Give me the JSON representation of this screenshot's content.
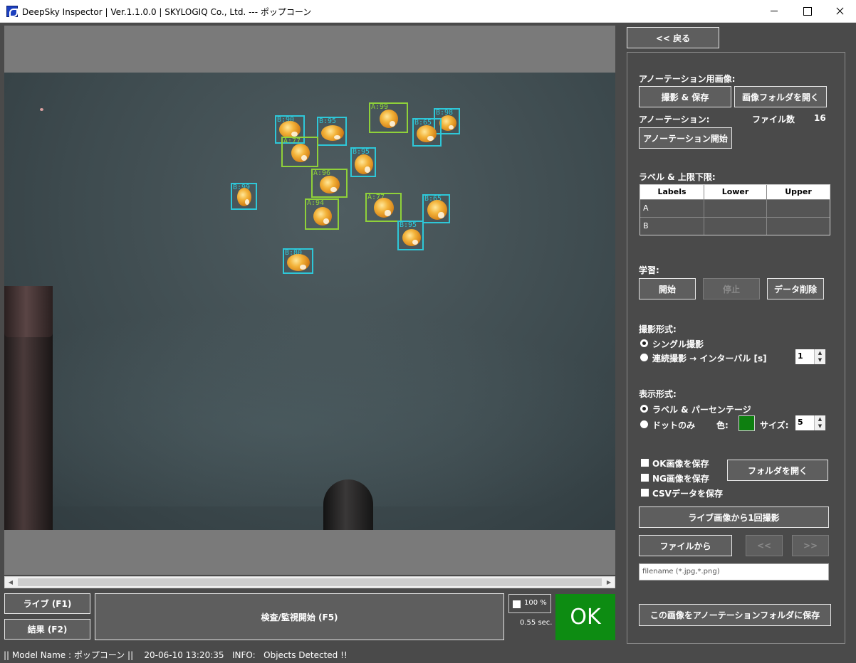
{
  "window": {
    "title": "DeepSky Inspector | Ver.1.1.0.0 | SKYLOGIQ Co., Ltd. --- ポップコーン"
  },
  "viewer": {
    "detections": [
      {
        "cls": "B",
        "label": "B:90"
      },
      {
        "cls": "B",
        "label": "B:95"
      },
      {
        "cls": "A",
        "label": "A:99"
      },
      {
        "cls": "B",
        "label": "B:98"
      },
      {
        "cls": "B",
        "label": "B:65"
      },
      {
        "cls": "A",
        "label": "A:77"
      },
      {
        "cls": "B",
        "label": "B:95"
      },
      {
        "cls": "A",
        "label": "A:96"
      },
      {
        "cls": "B",
        "label": "B:99"
      },
      {
        "cls": "A",
        "label": "A:94"
      },
      {
        "cls": "A",
        "label": "A:77"
      },
      {
        "cls": "B",
        "label": "B:65"
      },
      {
        "cls": "B",
        "label": "B:95"
      },
      {
        "cls": "B",
        "label": "B:80"
      }
    ]
  },
  "bottom": {
    "live_label": "ライブ (F1)",
    "result_label": "結果 (F2)",
    "inspect_label": "検査/監視開始 (F5)",
    "percent": "100 %",
    "elapsed": "0.55 sec.",
    "verdict": "OK"
  },
  "status": {
    "text": "|| Model Name : ポップコーン ||    20-06-10 13:20:35   INFO:   Objects Detected !!"
  },
  "panel": {
    "back_label": "<< 戻る",
    "annotation_image_heading": "アノーテーション用画像:",
    "capture_save_label": "撮影 & 保存",
    "open_image_folder_label": "画像フォルダを開く",
    "annotation_heading": "アノーテーション:",
    "file_count_label": "ファイル数",
    "file_count_value": "16",
    "start_annotation_label": "アノーテーション開始",
    "limits_heading": "ラベル & 上限下限:",
    "table": {
      "headers": [
        "Labels",
        "Lower",
        "Upper"
      ],
      "rows": [
        [
          "A",
          "",
          ""
        ],
        [
          "B",
          "",
          ""
        ]
      ]
    },
    "training_heading": "学習:",
    "train_start_label": "開始",
    "train_stop_label": "停止",
    "delete_data_label": "データ削除",
    "capture_mode_heading": "撮影形式:",
    "single_capture_label": "シングル撮影",
    "continuous_capture_label": "連続撮影 → インターバル [s]",
    "interval_value": "1",
    "display_mode_heading": "表示形式:",
    "label_percentage_label": "ラベル & パーセンテージ",
    "dots_only_label": "ドットのみ",
    "color_label": "色:",
    "size_label": "サイズ:",
    "size_value": "5",
    "dot_color": "#0e7f10",
    "save_ok_label": "OK画像を保存",
    "save_ng_label": "NG画像を保存",
    "save_csv_label": "CSVデータを保存",
    "open_folder_label": "フォルダを開く",
    "capture_once_label": "ライブ画像から1回撮影",
    "from_file_label": "ファイルから",
    "prev_label": "<<",
    "next_label": ">>",
    "filename_placeholder": "filename (*.jpg,*.png)",
    "save_to_annotation_label": "この画像をアノーテーションフォルダに保存"
  }
}
